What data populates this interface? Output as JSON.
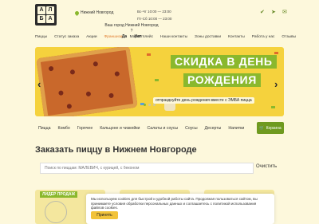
{
  "header": {
    "logo_letters": [
      "А",
      "Л",
      "Б",
      "А"
    ],
    "city": "Нижний Новгород",
    "hours": [
      "Вс-Чт 10:00 — 23:00",
      "Пт-Сб 10:00 — 23:00"
    ],
    "social_icons": [
      "vk-icon",
      "telegram-icon",
      "send-icon"
    ],
    "city_question": "Ваш город Нижний Новгород ?",
    "city_yes": "Да",
    "city_no": "Нет"
  },
  "topnav": {
    "items": [
      "Пиццы",
      "Статус заказа",
      "Акции",
      "Франшиза",
      "Маркетплейс",
      "Наши контакты",
      "Зоны доставки",
      "Контакты",
      "Работа у нас",
      "Отзывы"
    ]
  },
  "banner": {
    "title_line1": "СКИДКА В ДЕНЬ",
    "title_line2": "РОЖДЕНИЯ",
    "subtitle": "отпразднуйте день рождения вместе с ЭМБА пицца"
  },
  "catnav": {
    "items": [
      "Пицца",
      "Комбо",
      "Горячее",
      "Кальцоне и чизкейки",
      "Салаты и соусы",
      "Соусы",
      "Десерты",
      "Напитки"
    ],
    "cart_label": "Корзина"
  },
  "main": {
    "heading": "Заказать пиццу в Нижнем Новгороде",
    "search_placeholder": "Поиск по пиццам: МАЛЕВИЧ, с курицей, с беконом",
    "clear_label": "Очистить",
    "card_badge": "ЛИДЕР ПРОДАЖ"
  },
  "cookie": {
    "text": "Мы используем cookies для быстрой и удобной работы сайта. Продолжая пользоваться сайтом, вы принимаете условия обработки персональных данных и соглашаетесь с политикой использования файлов cookies.",
    "ok_label": "Принять"
  },
  "colors": {
    "accent_green": "#8ab82d",
    "cart_green": "#6f9a1f",
    "banner_yellow": "#f5d23d",
    "background": "#fdf8dc"
  }
}
